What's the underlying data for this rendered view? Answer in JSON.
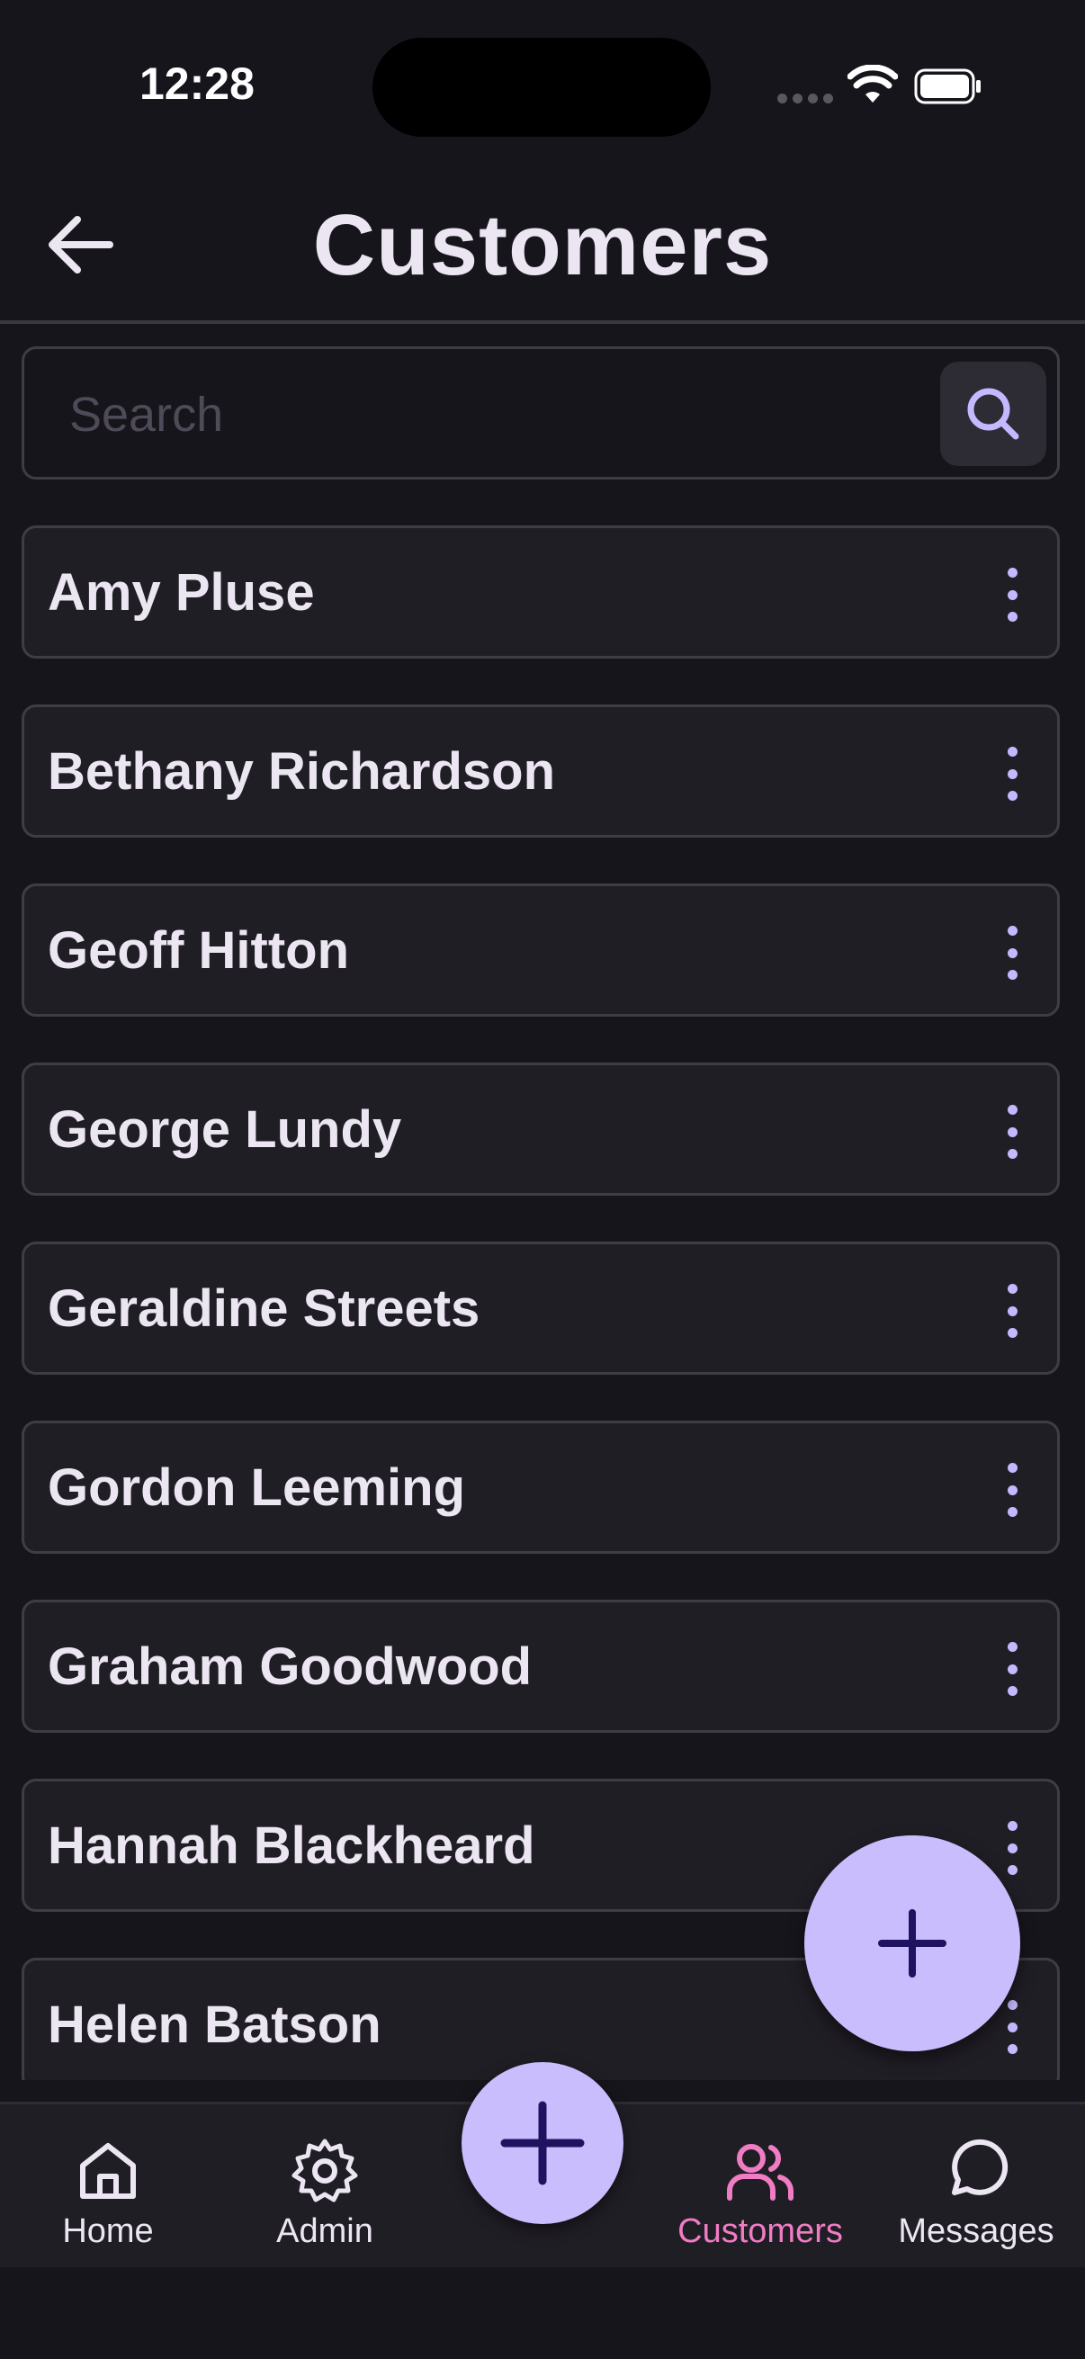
{
  "status_bar": {
    "time": "12:28"
  },
  "header": {
    "title": "Customers"
  },
  "search": {
    "placeholder": "Search",
    "value": ""
  },
  "customers": [
    {
      "name": "Amy Pluse"
    },
    {
      "name": "Bethany Richardson"
    },
    {
      "name": "Geoff Hitton"
    },
    {
      "name": "George Lundy"
    },
    {
      "name": "Geraldine Streets"
    },
    {
      "name": "Gordon Leeming"
    },
    {
      "name": "Graham Goodwood"
    },
    {
      "name": "Hannah Blackheard"
    },
    {
      "name": "Helen Batson"
    }
  ],
  "bottom_nav": {
    "items": [
      {
        "label": "Home",
        "icon": "home-icon",
        "active": false
      },
      {
        "label": "Admin",
        "icon": "gear-icon",
        "active": false
      },
      {
        "label": "Customers",
        "icon": "users-icon",
        "active": true
      },
      {
        "label": "Messages",
        "icon": "message-icon",
        "active": false
      }
    ]
  },
  "colors": {
    "background": "#17151c",
    "card": "#201e25",
    "accent": "#c9bdfd",
    "active_nav": "#f07cc4",
    "icon_dark": "#1f1360"
  }
}
